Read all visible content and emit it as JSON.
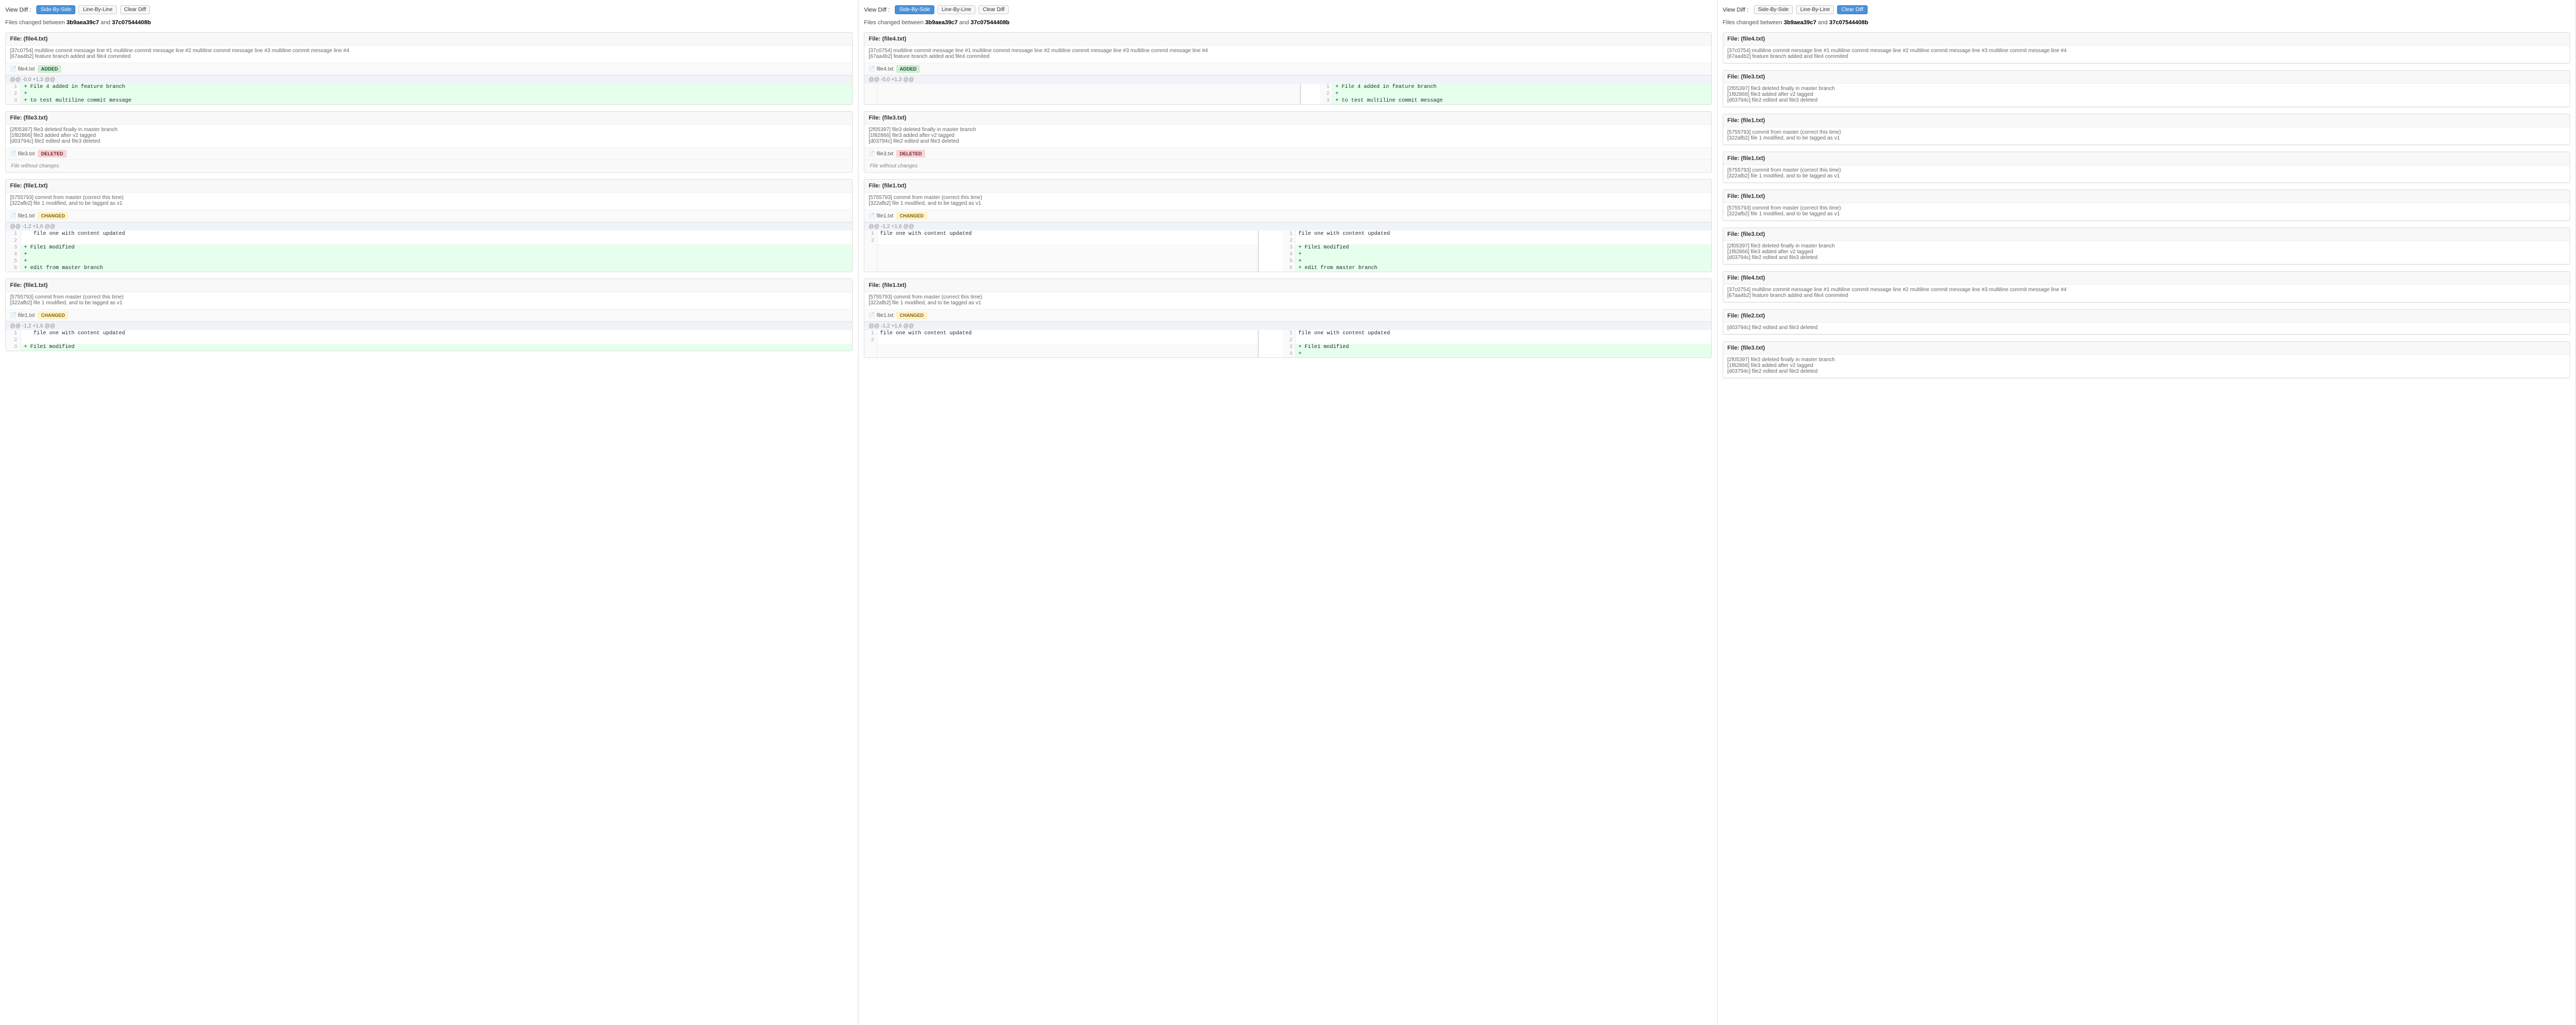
{
  "panels": [
    {
      "id": "panel-left",
      "toolbar": {
        "label": "View Diff :",
        "buttons": [
          {
            "id": "side-by-side",
            "label": "Side-By-Side",
            "active": true
          },
          {
            "id": "line-by-line",
            "label": "Line-By-Line",
            "active": false
          },
          {
            "id": "clear-diff",
            "label": "Clear Diff",
            "active": false
          }
        ]
      },
      "files_changed_text": "Files changed between ",
      "commit_from": "3b9aea39c7",
      "commit_to_text": " and ",
      "commit_to": "37c07544408b",
      "files": [
        {
          "id": "file4-left",
          "header": "File: (file4.txt)",
          "meta": "[37c0754] multiline commit message line #1 multiline commit message line #2 multiline commit message line #3 multiline commit message line #4\n[67aa4b2] feature branch added and file4 commited",
          "badge": "ADDED",
          "badge_type": "added",
          "filename": "file4.txt",
          "diff_type": "unified",
          "hunk": "@@ -0,0 +1,3 @@",
          "lines": [
            {
              "num": "1",
              "type": "add",
              "code": "+ File 4 added in feature branch"
            },
            {
              "num": "2",
              "type": "add",
              "code": "+"
            },
            {
              "num": "3",
              "type": "add",
              "code": "+ to test multiline commit message"
            }
          ]
        },
        {
          "id": "file3-left",
          "header": "File: (file3.txt)",
          "meta": "[2f05397] file3 deleted finally in master branch\n[1f82866] file3 added after v2 tagged\n[d03794c] file2 edited and file3 deleted",
          "badge": "DELETED",
          "badge_type": "deleted",
          "filename": "file3.txt",
          "diff_type": "no_change",
          "no_change_text": "File without changes"
        },
        {
          "id": "file1-left-1",
          "header": "File: (file1.txt)",
          "meta": "[5755793] commit from master (correct this time)\n[322afb2] file 1 modified, and to be tagged as v1",
          "badge": "CHANGED",
          "badge_type": "changed",
          "filename": "file1.txt",
          "diff_type": "unified",
          "hunk": "@@ -1,2 +1,6 @@",
          "lines": [
            {
              "num": "1",
              "type": "normal",
              "code": "   file one with content updated"
            },
            {
              "num": "2",
              "type": "normal",
              "code": ""
            },
            {
              "num": "3",
              "type": "add",
              "code": "+ File1 modified"
            },
            {
              "num": "4",
              "type": "add",
              "code": "+"
            },
            {
              "num": "5",
              "type": "add",
              "code": "+"
            },
            {
              "num": "6",
              "type": "add",
              "code": "+ edit from master branch"
            }
          ]
        },
        {
          "id": "file1-left-2",
          "header": "File: (file1.txt)",
          "meta": "[5755793] commit from master (correct this time)\n[322afb2] file 1 modified, and to be tagged as v1",
          "badge": "CHANGED",
          "badge_type": "changed",
          "filename": "file1.txt",
          "diff_type": "unified",
          "hunk": "@@ -1,2 +1,6 @@",
          "lines": [
            {
              "num": "1",
              "type": "normal",
              "code": "   file one with content updated"
            },
            {
              "num": "2",
              "type": "normal",
              "code": ""
            },
            {
              "num": "3",
              "type": "add",
              "code": "+ File1 modified"
            }
          ]
        }
      ]
    },
    {
      "id": "panel-middle",
      "toolbar": {
        "label": "View Diff :",
        "buttons": [
          {
            "id": "side-by-side",
            "label": "Side-By-Side",
            "active": true
          },
          {
            "id": "line-by-line",
            "label": "Line-By-Line",
            "active": false
          },
          {
            "id": "clear-diff",
            "label": "Clear Diff",
            "active": false
          }
        ]
      },
      "files_changed_text": "Files changed between ",
      "commit_from": "3b9aea39c7",
      "commit_to_text": " and ",
      "commit_to": "37c07544408b",
      "files": [
        {
          "id": "file4-mid",
          "header": "File: (file4.txt)",
          "meta": "[37c0754] multiline commit message line #1 multiline commit message line #2 multiline commit message line #3 multiline commit message line #4\n[67aa4b2] feature branch added and file4 commited",
          "badge": "ADDED",
          "badge_type": "added",
          "filename": "file4.txt",
          "diff_type": "side_by_side",
          "hunk": "@@ -0,0 +1,3 @@",
          "left_lines": [],
          "right_lines": [
            {
              "num": "1",
              "type": "add",
              "code": "+ File 4 added in feature branch"
            },
            {
              "num": "2",
              "type": "add",
              "code": "+"
            },
            {
              "num": "3",
              "type": "add",
              "code": "+ to test multiline commit message"
            }
          ]
        },
        {
          "id": "file3-mid",
          "header": "File: (file3.txt)",
          "meta": "[2f05397] file3 deleted finally in master branch\n[1f82866] file3 added after v2 tagged\n[d03794c] file2 edited and file3 deleted",
          "badge": "DELETED",
          "badge_type": "deleted",
          "filename": "file3.txt",
          "diff_type": "no_change",
          "no_change_text": "File without changes"
        },
        {
          "id": "file1-mid-1",
          "header": "File: (file1.txt)",
          "meta": "[5755793] commit from master (correct this time)\n[322afb2] file 1 modified, and to be tagged as v1",
          "badge": "CHANGED",
          "badge_type": "changed",
          "filename": "file1.txt",
          "diff_type": "side_by_side",
          "hunk": "@@ -1,2 +1,6 @@",
          "left_lines": [
            {
              "num": "1",
              "type": "normal",
              "code": "file one with content updated"
            },
            {
              "num": "2",
              "type": "normal",
              "code": ""
            }
          ],
          "right_lines": [
            {
              "num": "1",
              "type": "normal",
              "code": "file one with content updated"
            },
            {
              "num": "2",
              "type": "normal",
              "code": ""
            },
            {
              "num": "3",
              "type": "add",
              "code": "+ File1 modified"
            },
            {
              "num": "4",
              "type": "add",
              "code": "+"
            },
            {
              "num": "5",
              "type": "add",
              "code": "+"
            },
            {
              "num": "6",
              "type": "add",
              "code": "+ edit from master branch"
            }
          ]
        },
        {
          "id": "file1-mid-2",
          "header": "File: (file1.txt)",
          "meta": "[5755793] commit from master (correct this time)\n[322afb2] file 1 modified, and to be tagged as v1",
          "badge": "CHANGED",
          "badge_type": "changed",
          "filename": "file1.txt",
          "diff_type": "side_by_side",
          "hunk": "@@ -1,2 +1,6 @@",
          "left_lines": [
            {
              "num": "1",
              "type": "normal",
              "code": "file one with content updated"
            },
            {
              "num": "2",
              "type": "normal",
              "code": ""
            }
          ],
          "right_lines": [
            {
              "num": "1",
              "type": "normal",
              "code": "file one with content updated"
            },
            {
              "num": "2",
              "type": "normal",
              "code": ""
            },
            {
              "num": "3",
              "type": "add",
              "code": "+ File1 modified"
            },
            {
              "num": "4",
              "type": "add",
              "code": "+"
            }
          ]
        }
      ]
    },
    {
      "id": "panel-right",
      "toolbar": {
        "label": "View Diff :",
        "buttons": [
          {
            "id": "side-by-side",
            "label": "Side-By-Side",
            "active": false
          },
          {
            "id": "line-by-line",
            "label": "Line-By-Line",
            "active": false
          },
          {
            "id": "clear-diff",
            "label": "Clear Diff",
            "active": true
          }
        ]
      },
      "files_changed_text": "Files changed between ",
      "commit_from": "3b9aea39c7",
      "commit_to_text": " and ",
      "commit_to": "37c07544408b",
      "file_list": [
        {
          "header": "File: (file4.txt)",
          "meta": "[37c0754] multiline commit message line #1 multiline commit message line #2 multiline commit message line #3 multiline commit message line #4\n[67aa4b2] feature branch added and file4 commited"
        },
        {
          "header": "File: (file3.txt)",
          "meta": "[2f05397] file3 deleted finally in master branch\n[1f82866] file3 added after v2 tagged\n[d03794c] file2 edited and file3 deleted"
        },
        {
          "header": "File: (file1.txt)",
          "meta": "[5755793] commit from master (correct this time)\n[322afb2] file 1 modified, and to be tagged as v1"
        },
        {
          "header": "File: (file1.txt)",
          "meta": "[5755793] commit from master (correct this time)\n[322afb2] file 1 modified, and to be tagged as v1"
        },
        {
          "header": "File: (file1.txt)",
          "meta": "[5755793] commit from master (correct this time)\n[322afb2] file 1 modified, and to be tagged as v1"
        },
        {
          "header": "File: (file3.txt)",
          "meta": "[2f05397] file3 deleted finally in master branch\n[1f82866] file3 added after v2 tagged\n[d03794c] file2 edited and file3 deleted"
        },
        {
          "header": "File: (file4.txt)",
          "meta": "[37c0754] multiline commit message line #1 multiline commit message line #2 multiline commit message line #3 multiline commit message line #4\n[67aa4b2] feature branch added and file4 commited"
        },
        {
          "header": "File: (file2.txt)",
          "meta": "[d03794c] file2 edited and file3 deleted"
        },
        {
          "header": "File: (file3.txt)",
          "meta": "[2f05397] file3 deleted finally in master branch\n[1f82866] file3 added after v2 tagged\n[d03794c] file2 edited and file3 deleted"
        }
      ]
    }
  ]
}
